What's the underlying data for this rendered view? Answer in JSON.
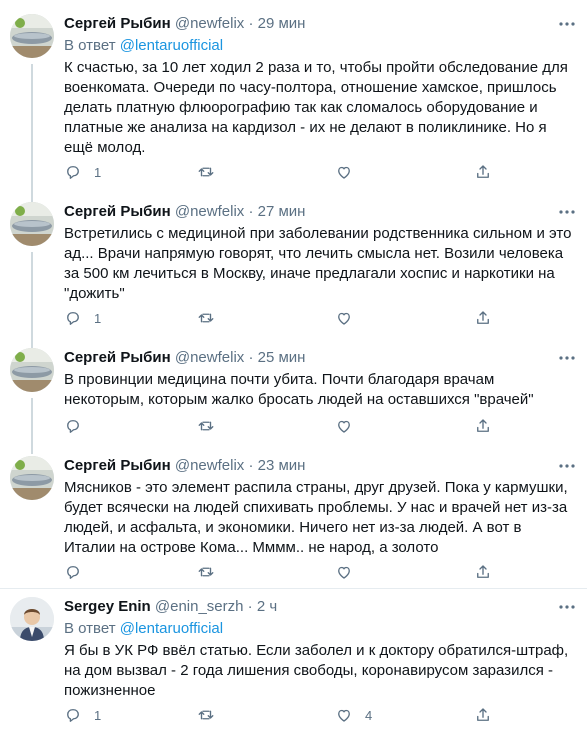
{
  "tweets": [
    {
      "name": "Сергей Рыбин",
      "handle": "@newfelix",
      "dot": "·",
      "time": "29 мин",
      "reply_prefix": "В ответ",
      "reply_mention": "@lentaruofficial",
      "text": "К счастью, за 10 лет ходил 2 раза и то, чтобы пройти обследование для военкомата. Очереди по часу-полтора, отношение хамское, пришлось делать платную флюорографию так как сломалось оборудование и платные же анализа на кардизол - их не делают в поликлинике. Но я ещё молод.",
      "reply_count": "1",
      "like_count": ""
    },
    {
      "name": "Сергей Рыбин",
      "handle": "@newfelix",
      "dot": "·",
      "time": "27 мин",
      "text": "Встретились с медициной при заболевании родственника сильном и это ад... Врачи напрямую говорят, что лечить смысла нет. Возили человека за 500 км лечиться в Москву, иначе предлагали хоспис и наркотики на \"дожить\"",
      "reply_count": "1",
      "like_count": ""
    },
    {
      "name": "Сергей Рыбин",
      "handle": "@newfelix",
      "dot": "·",
      "time": "25 мин",
      "text": "В провинции медицина почти убита. Почти благодаря врачам некоторым, которым жалко бросать людей на оставшихся \"врачей\"",
      "reply_count": "",
      "like_count": ""
    },
    {
      "name": "Сергей Рыбин",
      "handle": "@newfelix",
      "dot": "·",
      "time": "23 мин",
      "text": "Мясников - это элемент распила страны, друг друзей. Пока у кармушки, будет всячески на людей спихивать проблемы. У нас и врачей нет из-за людей, и асфальта, и экономики. Ничего нет из-за людей. А вот в Италии на острове Кома... Мммм.. не народ, а золото",
      "reply_count": "",
      "like_count": ""
    },
    {
      "name": "Sergey Enin",
      "handle": "@enin_serzh",
      "dot": "·",
      "time": "2 ч",
      "reply_prefix": "В ответ",
      "reply_mention": "@lentaruofficial",
      "text": "Я бы в УК РФ ввёл статью. Если заболел и к доктору обратился-штраф, на дом вызвал - 2 года лишения свободы, коронавирусом заразился - пожизненное",
      "reply_count": "1",
      "like_count": "4"
    }
  ],
  "icons": {
    "reply": "reply-icon",
    "retweet": "retweet-icon",
    "like": "like-icon",
    "share": "share-icon",
    "more": "more-icon"
  },
  "colors": {
    "link": "#1b95e0",
    "secondary": "#5b7083",
    "divider": "#e6ecf0"
  }
}
